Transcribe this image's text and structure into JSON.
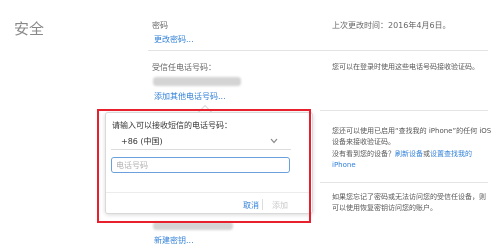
{
  "section": {
    "title": "安全"
  },
  "password": {
    "label": "密码",
    "change_link": "更改密码...",
    "last_changed": "上次更改时间：2016年4月6日。"
  },
  "trusted_phone": {
    "label": "受信任电话号码：",
    "add_link": "添加其他电话号码...",
    "note": "您可以在登录时使用这些电话号码接收验证码。"
  },
  "popover": {
    "prompt": "请输入可以接收短信的电话号码：",
    "country_value": "+86 (中国)",
    "phone_placeholder": "电话号码",
    "cancel_button": "取消",
    "add_button": "添加"
  },
  "find_iphone_note": {
    "text": "您还可以使用已启用“查找我的 iPhone”的任何 iOS 设备来接收验证码。",
    "question": "没有看到您的设备？",
    "refresh_link": "刷新设备",
    "or": "或",
    "setup_link": "设置查找我的 iPhone"
  },
  "recovery": {
    "link": "新建密钥...",
    "note": "如果您忘记了密码或无法访问您的受信任设备，则可以使用恢复密钥访问您的账户。"
  }
}
